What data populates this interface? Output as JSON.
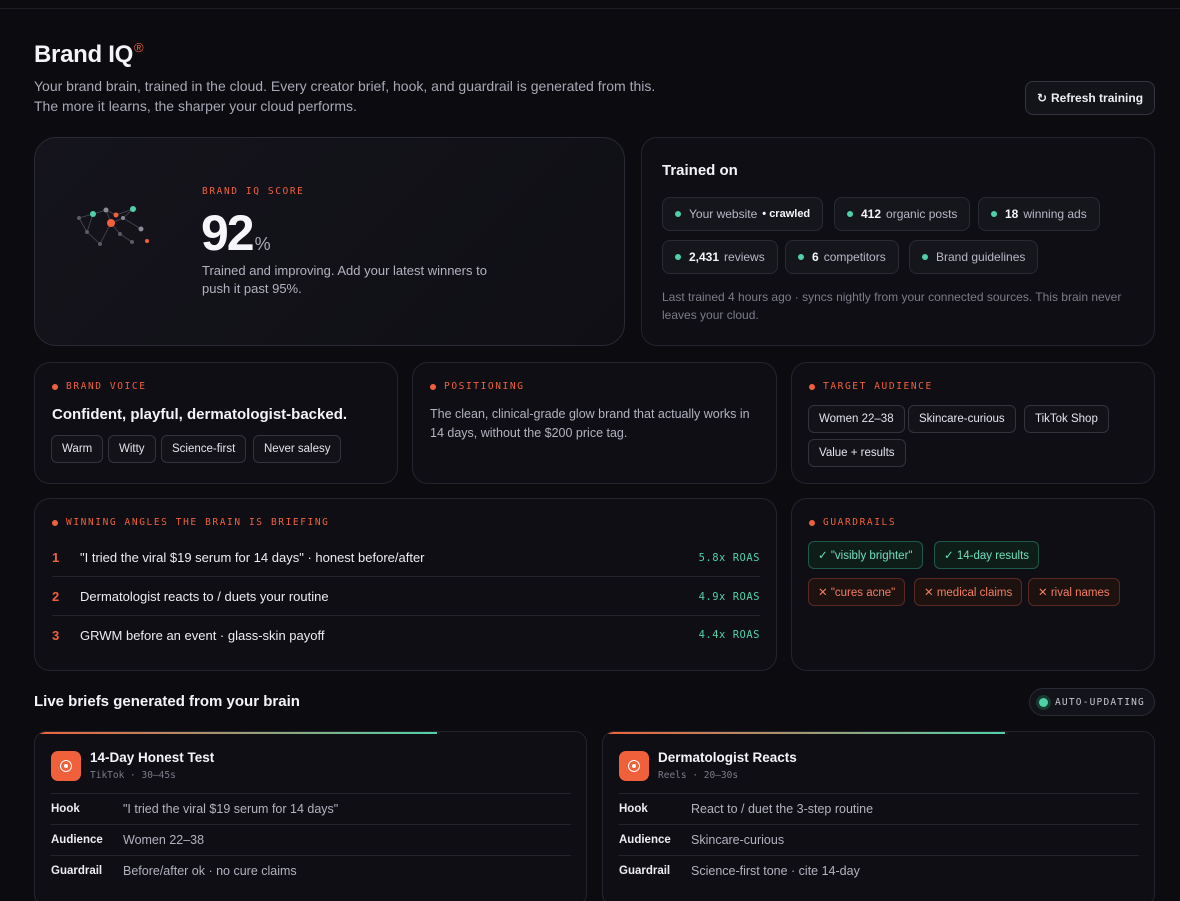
{
  "header": {
    "title": "Brand IQ",
    "title_mark": "®",
    "subtitle_line1": "Your brand brain, trained in the cloud. Every creator brief, hook, and guardrail is generated from this.",
    "subtitle_line2": "The more it learns, the sharper your cloud performs.",
    "refresh_icon": "↻",
    "refresh_label": "Refresh training"
  },
  "score": {
    "eyebrow": "BRAND IQ SCORE",
    "value": "92",
    "unit": "%",
    "description": "Trained and improving. Add your latest winners to push it past 95%."
  },
  "trained": {
    "title": "Trained on",
    "sources": [
      {
        "label": "Your website",
        "badge": "• crawled"
      },
      {
        "count": "412",
        "label": "organic posts"
      },
      {
        "count": "18",
        "label": "winning ads"
      },
      {
        "count": "2,431",
        "label": "reviews"
      },
      {
        "count": "6",
        "label": "competitors"
      },
      {
        "label": "Brand guidelines"
      }
    ],
    "footnote": "Last trained 4 hours ago · syncs nightly from your connected sources. This brain never leaves your cloud."
  },
  "voice": {
    "eyebrow": "BRAND VOICE",
    "headline": "Confident, playful, dermatologist-backed.",
    "tags": [
      "Warm",
      "Witty",
      "Science-first",
      "Never salesy"
    ]
  },
  "positioning": {
    "eyebrow": "POSITIONING",
    "text": "The clean, clinical-grade glow brand that actually works in 14 days, without the $200 price tag."
  },
  "audience": {
    "eyebrow": "TARGET AUDIENCE",
    "tags": [
      "Women 22–38",
      "Skincare-curious",
      "TikTok Shop",
      "Value + results"
    ]
  },
  "angles": {
    "eyebrow": "WINNING ANGLES THE BRAIN IS BRIEFING",
    "items": [
      {
        "rank": "1",
        "text": "\"I tried the viral $19 serum for 14 days\" · honest before/after",
        "roas": "5.8x ROAS"
      },
      {
        "rank": "2",
        "text": "Dermatologist reacts to / duets your routine",
        "roas": "4.9x ROAS"
      },
      {
        "rank": "3",
        "text": "GRWM before an event · glass-skin payoff",
        "roas": "4.4x ROAS"
      }
    ]
  },
  "guardrails": {
    "eyebrow": "GUARDRAILS",
    "allowed": [
      "✓ \"visibly brighter\"",
      "✓ 14-day results"
    ],
    "blocked": [
      "✕ \"cures acne\"",
      "✕ medical claims",
      "✕ rival names"
    ]
  },
  "live": {
    "title": "Live briefs generated from your brain",
    "badge": "AUTO-UPDATING",
    "briefs": [
      {
        "title": "14-Day Honest Test",
        "meta": "TikTok · 30–45s",
        "progress": 0.73,
        "rows": [
          {
            "key": "Hook",
            "value": "\"I tried the viral $19 serum for 14 days\""
          },
          {
            "key": "Audience",
            "value": "Women 22–38"
          },
          {
            "key": "Guardrail",
            "value": "Before/after ok · no cure claims"
          }
        ]
      },
      {
        "title": "Dermatologist Reacts",
        "meta": "Reels · 20–30s",
        "progress": 0.73,
        "rows": [
          {
            "key": "Hook",
            "value": "React to / duet the 3-step routine"
          },
          {
            "key": "Audience",
            "value": "Skincare-curious"
          },
          {
            "key": "Guardrail",
            "value": "Science-first tone · cite 14-day"
          }
        ]
      }
    ]
  },
  "colors": {
    "accent": "#f0613b",
    "success": "#4fd1a7",
    "background": "#0b0b10"
  }
}
